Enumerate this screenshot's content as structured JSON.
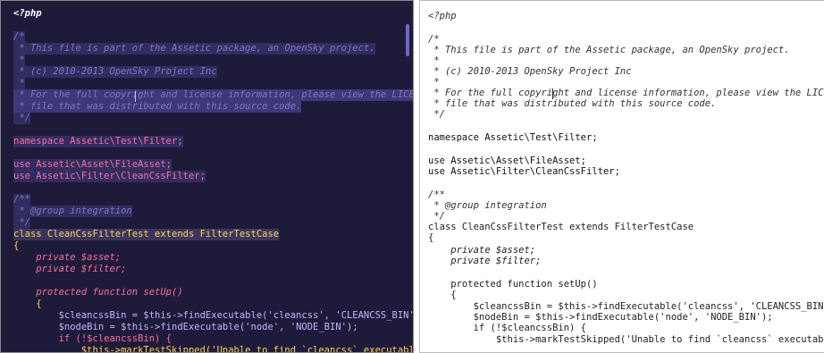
{
  "colors": {
    "dark_bg": "#1e1b3a",
    "dark_comment": "#7e76c9",
    "dark_keyword": "#ff6b9a",
    "dark_brace": "#ffd34d",
    "light_bg": "#ffffff",
    "light_text": "#222222"
  },
  "left_pane": {
    "lines": [
      "<?php",
      "",
      "/*",
      " * This file is part of the Assetic package, an OpenSky project.",
      " *",
      " * (c) 2010-2013 OpenSky Project Inc",
      " *",
      " * For the full copyright and license information, please view the LICENSE",
      " * file that was distributed with this source code.",
      " */",
      "",
      "namespace Assetic\\Test\\Filter;",
      "",
      "use Assetic\\Asset\\FileAsset;",
      "use Assetic\\Filter\\CleanCssFilter;",
      "",
      "/**",
      " * @group integration",
      " */",
      "class CleanCssFilterTest extends FilterTestCase",
      "{",
      "    private $asset;",
      "    private $filter;",
      "",
      "    protected function setUp()",
      "    {",
      "        $cleancssBin = $this->findExecutable('cleancss', 'CLEANCSS_BIN');",
      "        $nodeBin = $this->findExecutable('node', 'NODE_BIN');",
      "        if (!$cleancssBin) {",
      "            $this->markTestSkipped('Unable to find `cleancss` executable.');"
    ]
  },
  "right_pane": {
    "lines": [
      "<?php",
      "",
      "/*",
      " * This file is part of the Assetic package, an OpenSky project.",
      " *",
      " * (c) 2010-2013 OpenSky Project Inc",
      " *",
      " * For the full copyright and license information, please view the LICENSE",
      " * file that was distributed with this source code.",
      " */",
      "",
      "namespace Assetic\\Test\\Filter;",
      "",
      "use Assetic\\Asset\\FileAsset;",
      "use Assetic\\Filter\\CleanCssFilter;",
      "",
      "/**",
      " * @group integration",
      " */",
      "class CleanCssFilterTest extends FilterTestCase",
      "{",
      "    private $asset;",
      "    private $filter;",
      "",
      "    protected function setUp()",
      "    {",
      "        $cleancssBin = $this->findExecutable('cleancss', 'CLEANCSS_BIN');",
      "        $nodeBin = $this->findExecutable('node', 'NODE_BIN');",
      "        if (!$cleancssBin) {",
      "            $this->markTestSkipped('Unable to find `cleancss` executable.')"
    ]
  }
}
